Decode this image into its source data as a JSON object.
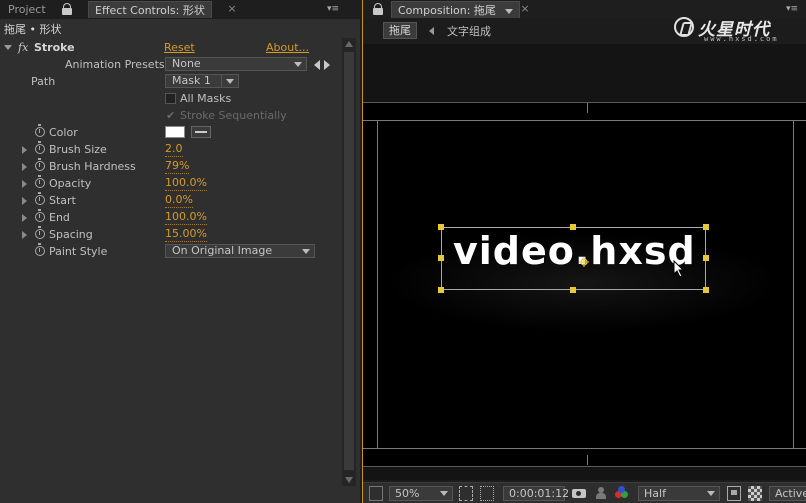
{
  "left_panel": {
    "tabs": [
      {
        "label": "Project"
      },
      {
        "label": "Effect Controls: 形状"
      }
    ],
    "layer_title": "拖尾 • 形状",
    "effect": {
      "name": "Stroke",
      "reset_label": "Reset",
      "about_label": "About..."
    },
    "animation_presets": {
      "label": "Animation Presets:",
      "value": "None"
    },
    "path": {
      "label": "Path",
      "value": "Mask 1"
    },
    "all_masks": {
      "label": "All Masks",
      "checked": false
    },
    "stroke_sequentially": {
      "label": "Stroke Sequentially",
      "checked": true,
      "disabled": true
    },
    "properties": [
      {
        "label": "Color",
        "value": "",
        "swatch": "#ffffff"
      },
      {
        "label": "Brush Size",
        "value": "2.0"
      },
      {
        "label": "Brush Hardness",
        "value": "79%"
      },
      {
        "label": "Opacity",
        "value": "100.0%"
      },
      {
        "label": "Start",
        "value": "0.0%"
      },
      {
        "label": "End",
        "value": "100.0%"
      },
      {
        "label": "Spacing",
        "value": "15.00%"
      }
    ],
    "paint_style": {
      "label": "Paint Style",
      "value": "On Original Image"
    }
  },
  "right_panel": {
    "tab": {
      "label": "Composition: 拖尾"
    },
    "viewer_tab": "拖尾",
    "breadcrumb": "文字组成",
    "logo": {
      "main": "火星时代",
      "sub": "www.hxsd.com"
    },
    "comp_text": "video.hxsd",
    "toolbar": {
      "zoom": "50%",
      "timecode": "0:00:01:12",
      "resolution": "Half",
      "camera": "Active"
    }
  },
  "colors": {
    "accent": "#d59b2a",
    "handle": "#e6c93a",
    "panel_bg": "#2f2f2f",
    "active_border": "#c8941e"
  }
}
